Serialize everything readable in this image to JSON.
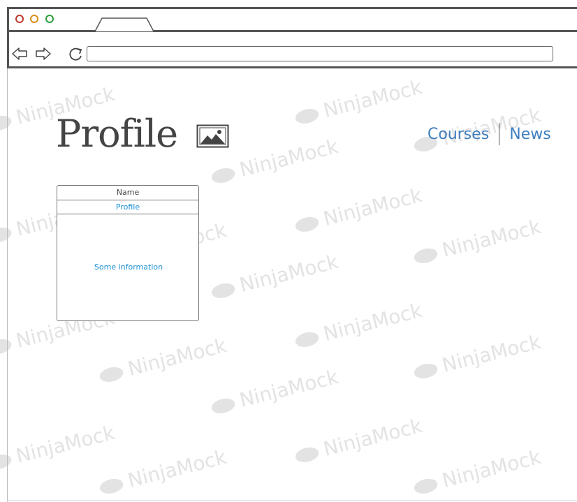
{
  "browser": {
    "window_controls": [
      "close",
      "minimize",
      "maximize"
    ],
    "nav_buttons": [
      "back-arrow-icon",
      "forward-arrow-icon",
      "refresh-icon"
    ],
    "address_value": ""
  },
  "page": {
    "title": "Profile",
    "image_icon": "image-placeholder-icon",
    "nav": {
      "courses": "Courses",
      "news": "News"
    },
    "card": {
      "header": "Name",
      "selected_item": "Profile",
      "info": "Some information"
    }
  },
  "watermark": {
    "text": "NinjaMock"
  },
  "colors": {
    "link": "#3f7fbf",
    "selected": "#1a8fd6",
    "chrome_border": "#555555",
    "close_dot": "#c0392b",
    "minimize_dot": "#d98c1a",
    "maximize_dot": "#2e9e3a"
  }
}
